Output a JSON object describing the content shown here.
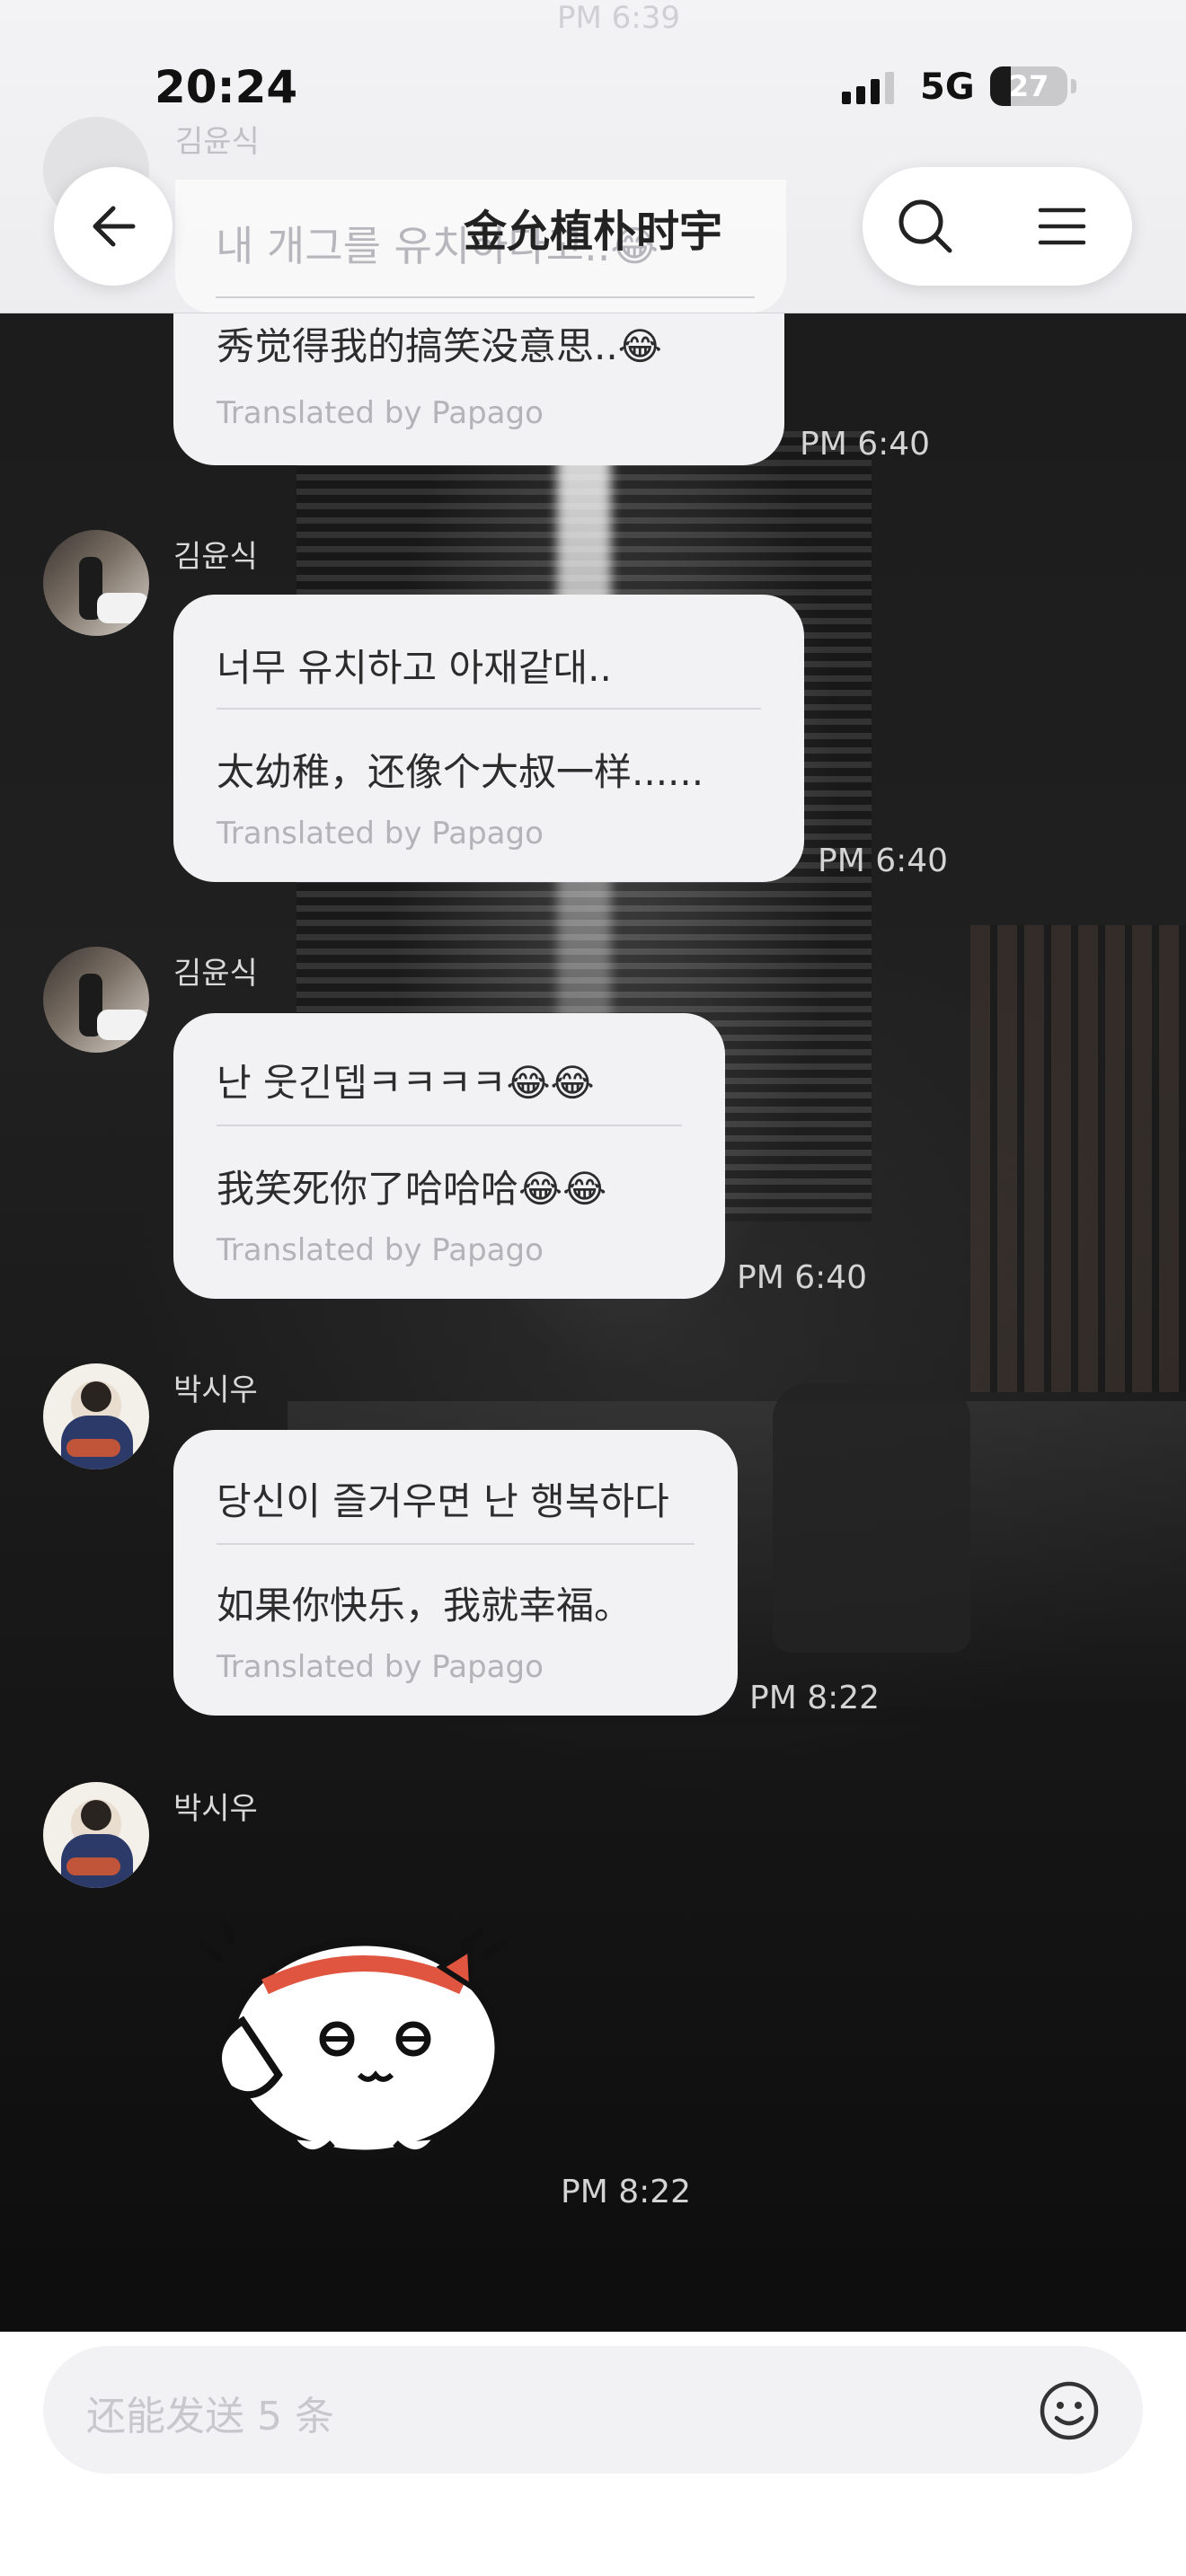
{
  "status_bar": {
    "time": "20:24",
    "network": "5G",
    "battery": "27",
    "battery_level_percent": 27
  },
  "header": {
    "title": "金允植朴时宇",
    "back_icon": "back-arrow-icon",
    "search_icon": "search-icon",
    "menu_icon": "menu-icon",
    "scrolled_under": {
      "time": "PM 6:39",
      "sender": "김윤식",
      "text": "내 개그를 유치하다고..😂"
    }
  },
  "messages": [
    {
      "sender": "",
      "original": "",
      "translation": "秀觉得我的搞笑没意思..😂",
      "credit": "Translated by Papago",
      "time": "PM 6:40"
    },
    {
      "sender": "김윤식",
      "original": "너무 유치하고 아재같대..",
      "translation": "太幼稚，还像个大叔一样......",
      "credit": "Translated by Papago",
      "time": "PM 6:40"
    },
    {
      "sender": "김윤식",
      "original": "난 웃긴뎁ㅋㅋㅋㅋ😂😂",
      "translation": "我笑死你了哈哈哈😂😂",
      "credit": "Translated by Papago",
      "time": "PM 6:40"
    },
    {
      "sender": "박시우",
      "original": "당신이 즐거우면 난 행복하다",
      "translation": "如果你快乐，我就幸福。",
      "credit": "Translated by Papago",
      "time": "PM 8:22"
    },
    {
      "sender": "박시우",
      "sticker": "saluting-bun-sticker",
      "time": "PM 8:22"
    }
  ],
  "input": {
    "placeholder": "还能发送 5 条",
    "emoji_icon": "smiley-icon"
  },
  "colors": {
    "bubble": "#f2f2f5",
    "header_bg": "#f0f0f2",
    "text": "#2c2c2c",
    "credit": "#b3b3b8",
    "timestamp": "#d4d4d4"
  }
}
